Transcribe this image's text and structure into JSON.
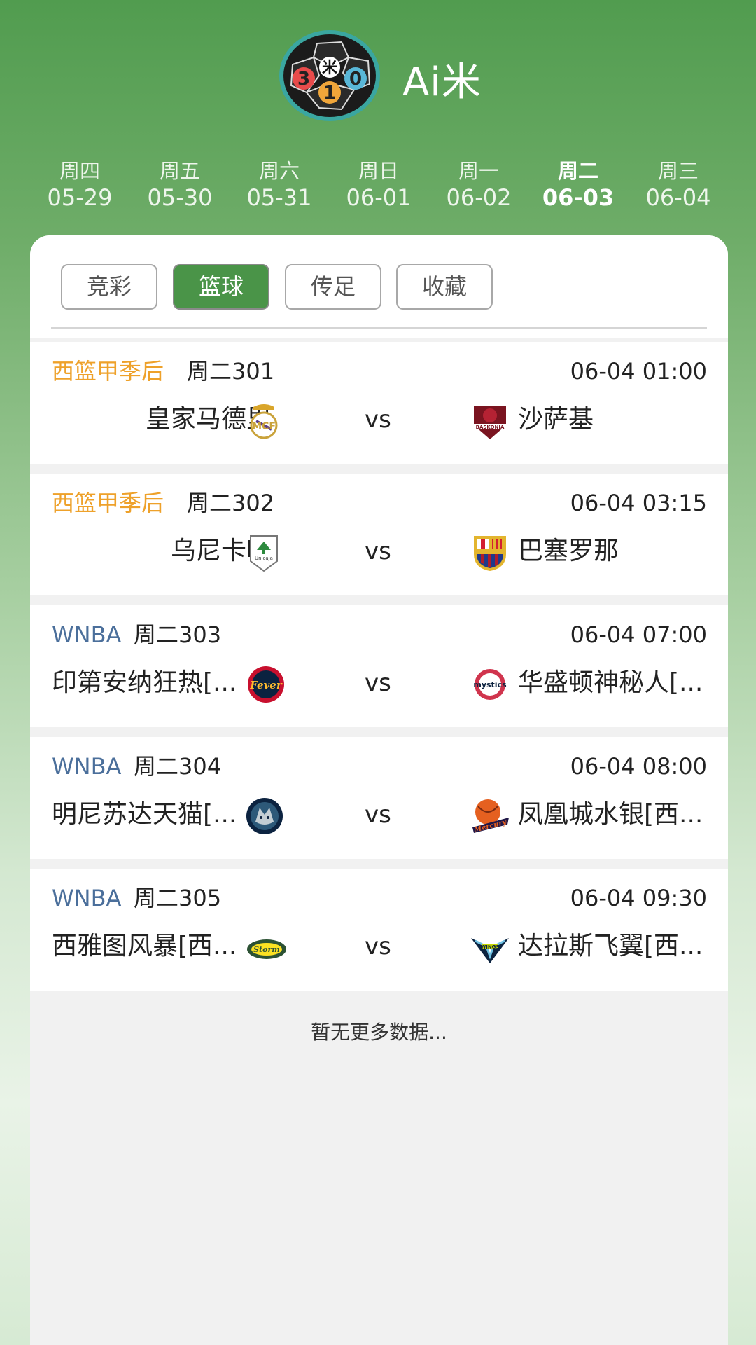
{
  "app": {
    "title": "Ai米",
    "logo_text": "3 米 1 0"
  },
  "dates": [
    {
      "dow": "周四",
      "md": "05-29"
    },
    {
      "dow": "周五",
      "md": "05-30"
    },
    {
      "dow": "周六",
      "md": "05-31"
    },
    {
      "dow": "周日",
      "md": "06-01"
    },
    {
      "dow": "周一",
      "md": "06-02"
    },
    {
      "dow": "周二",
      "md": "06-03",
      "active": true
    },
    {
      "dow": "周三",
      "md": "06-04"
    }
  ],
  "filters": [
    {
      "label": "竞彩"
    },
    {
      "label": "篮球",
      "active": true
    },
    {
      "label": "传足"
    },
    {
      "label": "收藏"
    }
  ],
  "matches": [
    {
      "league": "西篮甲季后",
      "league_color": "#eea12a",
      "code": "周二301",
      "time": "06-04 01:00",
      "home": "皇家马德里",
      "away": "沙萨基",
      "vs": "vs",
      "home_icon": "real-madrid-crest-icon",
      "away_icon": "baskonia-crest-icon"
    },
    {
      "league": "西篮甲季后",
      "league_color": "#eea12a",
      "code": "周二302",
      "time": "06-04 03:15",
      "home": "乌尼卡哈",
      "away": "巴塞罗那",
      "vs": "vs",
      "home_icon": "unicaja-crest-icon",
      "away_icon": "fc-barcelona-crest-icon"
    },
    {
      "league": "WNBA",
      "league_color": "#4b6f9b",
      "code": "周二303",
      "time": "06-04 07:00",
      "home": "印第安纳狂热[...",
      "away": "华盛顿神秘人[...",
      "vs": "vs",
      "home_icon": "indiana-fever-logo-icon",
      "away_icon": "washington-mystics-logo-icon"
    },
    {
      "league": "WNBA",
      "league_color": "#4b6f9b",
      "code": "周二304",
      "time": "06-04 08:00",
      "home": "明尼苏达天猫[...",
      "away": "凤凰城水银[西...",
      "vs": "vs",
      "home_icon": "minnesota-lynx-logo-icon",
      "away_icon": "phoenix-mercury-logo-icon"
    },
    {
      "league": "WNBA",
      "league_color": "#4b6f9b",
      "code": "周二305",
      "time": "06-04 09:30",
      "home": "西雅图风暴[西...",
      "away": "达拉斯飞翼[西...",
      "vs": "vs",
      "home_icon": "seattle-storm-logo-icon",
      "away_icon": "dallas-wings-logo-icon"
    }
  ],
  "footer": {
    "no_more": "暂无更多数据..."
  }
}
